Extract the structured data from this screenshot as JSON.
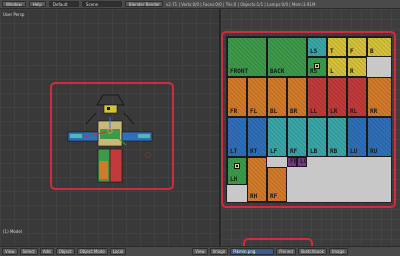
{
  "topbar": {
    "menus": [
      "Window",
      "Help"
    ],
    "layout": "Default",
    "scene": "Scene",
    "engine": "Blender Render",
    "stats": "v2.71 | Verts:0/0 | Faces:0/0 | Tris:0 | Objects:1/1 | Lamps:0/0 | Mem:3.91M"
  },
  "viewport": {
    "view_label": "User Persp",
    "object_label": "(1) Model"
  },
  "bottombar": {
    "items_left": [
      "View",
      "Select",
      "Add",
      "Object",
      "Object Mode",
      "Local"
    ],
    "items_right": [
      "View",
      "Image",
      "Pinned",
      "Sketchbook",
      "Image"
    ],
    "image_name": "Pikmin.png"
  },
  "atlas": {
    "tiles": [
      {
        "label": "FRONT",
        "color": "green"
      },
      {
        "label": "BACK",
        "color": "green"
      },
      {
        "label": "LS",
        "color": "teal"
      },
      {
        "label": "T",
        "color": "yellow"
      },
      {
        "label": "F",
        "color": "yellow"
      },
      {
        "label": "B",
        "color": "yellow"
      },
      {
        "label": "RS",
        "color": "green"
      },
      {
        "label": "L",
        "color": "yellow"
      },
      {
        "label": "R",
        "color": "yellow"
      },
      {
        "label": "FR",
        "color": "orange"
      },
      {
        "label": "FL",
        "color": "orange"
      },
      {
        "label": "BL",
        "color": "orange"
      },
      {
        "label": "BR",
        "color": "orange"
      },
      {
        "label": "LL",
        "color": "red"
      },
      {
        "label": "LR",
        "color": "red"
      },
      {
        "label": "RL",
        "color": "red"
      },
      {
        "label": "RR",
        "color": "orange"
      },
      {
        "label": "LT",
        "color": "blue"
      },
      {
        "label": "RT",
        "color": "blue"
      },
      {
        "label": "LF",
        "color": "teal"
      },
      {
        "label": "RF",
        "color": "teal"
      },
      {
        "label": "LB",
        "color": "teal"
      },
      {
        "label": "RB",
        "color": "teal"
      },
      {
        "label": "LU",
        "color": "blue"
      },
      {
        "label": "RU",
        "color": "blue"
      },
      {
        "label": "LH",
        "color": "green"
      },
      {
        "label": "RH",
        "color": "orange"
      },
      {
        "label": "RF",
        "color": "orange"
      },
      {
        "label": "FE",
        "color": "purple"
      },
      {
        "label": "LC",
        "color": "purple"
      }
    ]
  },
  "colors": {
    "highlight": "#d22b3b"
  }
}
